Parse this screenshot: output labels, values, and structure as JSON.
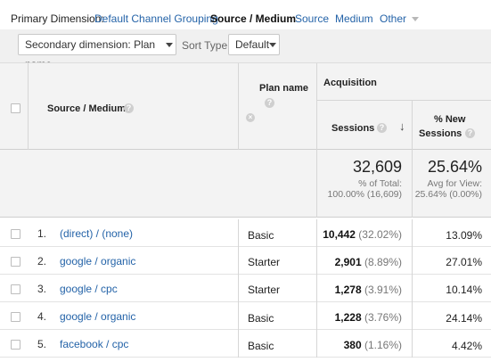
{
  "primary_dimension": {
    "label": "Primary Dimension:",
    "options": [
      "Default Channel Grouping",
      "Source / Medium",
      "Source",
      "Medium",
      "Other"
    ],
    "active": "Source / Medium"
  },
  "controls": {
    "secondary_dimension": "Secondary dimension: Plan name",
    "sort_type_label": "Sort Type:",
    "sort_type_value": "Default"
  },
  "table": {
    "headers": {
      "source_medium": "Source / Medium",
      "plan_name": "Plan name",
      "acquisition": "Acquisition",
      "sessions": "Sessions",
      "new_sessions_line1": "% New",
      "new_sessions_line2": "Sessions"
    },
    "totals": {
      "sessions": "32,609",
      "sessions_sub1": "% of Total:",
      "sessions_sub2": "100.00% (16,609)",
      "new_sessions": "25.64%",
      "new_sessions_sub1": "Avg for View:",
      "new_sessions_sub2": "25.64% (0.00%)"
    },
    "rows": [
      {
        "num": "1.",
        "source": "(direct) / (none)",
        "plan": "Basic",
        "sessions": "10,442",
        "sessions_pct": "(32.02%)",
        "new_sessions": "13.09%"
      },
      {
        "num": "2.",
        "source": "google / organic",
        "plan": "Starter",
        "sessions": "2,901",
        "sessions_pct": "(8.89%)",
        "new_sessions": "27.01%"
      },
      {
        "num": "3.",
        "source": "google / cpc",
        "plan": "Starter",
        "sessions": "1,278",
        "sessions_pct": "(3.91%)",
        "new_sessions": "10.14%"
      },
      {
        "num": "4.",
        "source": "google / organic",
        "plan": "Basic",
        "sessions": "1,228",
        "sessions_pct": "(3.76%)",
        "new_sessions": "24.14%"
      },
      {
        "num": "5.",
        "source": "facebook / cpc",
        "plan": "Basic",
        "sessions": "380",
        "sessions_pct": "(1.16%)",
        "new_sessions": "4.42%"
      }
    ]
  },
  "icons": {
    "help": "help-icon",
    "remove": "remove-dimension-icon",
    "sort": "sort-descending-icon",
    "caret": "chevron-down-icon"
  }
}
